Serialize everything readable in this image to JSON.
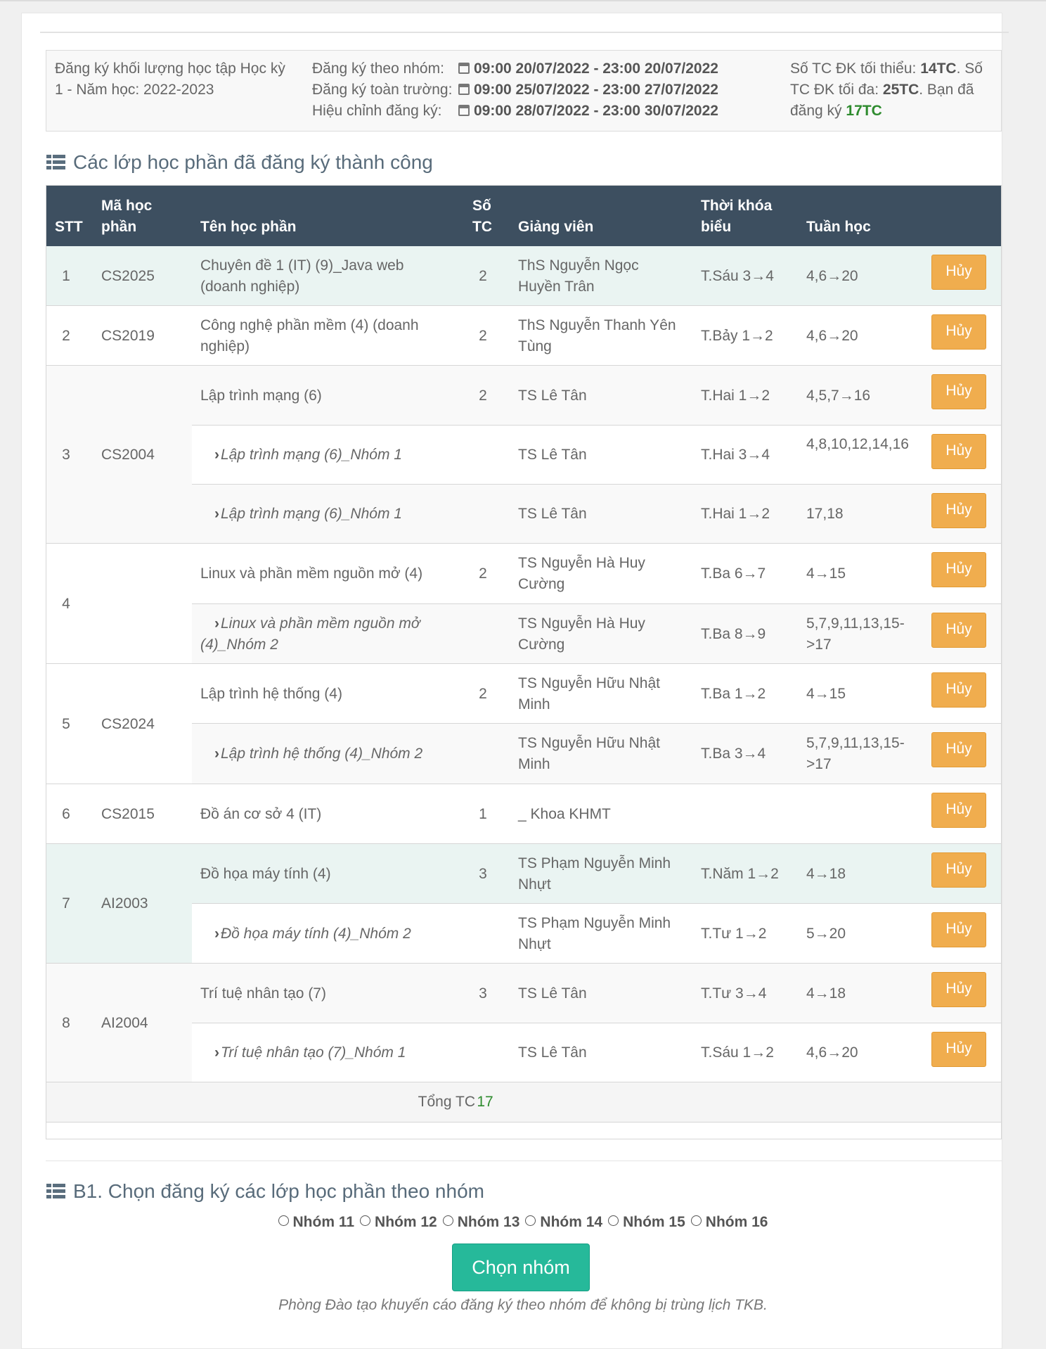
{
  "info": {
    "semester": "Đăng ký khối lượng học tập Học kỳ 1 - Năm học: 2022-2023",
    "periods": [
      {
        "label": "Đăng ký theo nhóm:",
        "value": "09:00 20/07/2022 - 23:00 20/07/2022"
      },
      {
        "label": "Đăng ký toàn trường:",
        "value": "09:00 25/07/2022 - 23:00 27/07/2022"
      },
      {
        "label": "Hiệu chỉnh đăng ký:",
        "value": "09:00 28/07/2022 - 23:00 30/07/2022"
      }
    ],
    "min_label": "Số TC ĐK tối thiểu:",
    "min_value": "14TC",
    "max_label": "Số TC ĐK tối đa:",
    "max_value": "25TC",
    "registered_label": "Bạn đã đăng ký",
    "registered_value": "17TC"
  },
  "section1_title": "Các lớp học phần đã đăng ký thành công",
  "table": {
    "headers": {
      "stt": "STT",
      "code": "Mã học phần",
      "name": "Tên học phần",
      "credits": "Số TC",
      "lecturer": "Giảng viên",
      "schedule": "Thời khóa biểu",
      "weeks": "Tuần học"
    },
    "cancel_label": "Hủy",
    "rows": [
      {
        "stt": "1",
        "code": "CS2025",
        "name": "Chuyên đề 1 (IT) (9)_Java web (doanh nghiệp)",
        "credits": "2",
        "lecturer": "ThS Nguyễn Ngọc Huyền Trân",
        "schedule": "T.Sáu 3→4",
        "weeks": "4,6→20"
      },
      {
        "stt": "2",
        "code": "CS2019",
        "name": "Công nghệ phần mềm (4) (doanh nghiệp)",
        "credits": "2",
        "lecturer": "ThS Nguyễn Thanh Yên Tùng",
        "schedule": "T.Bảy 1→2",
        "weeks": "4,6→20"
      },
      {
        "stt": "3",
        "code": "CS2004",
        "name": "Lập trình mạng (6)",
        "credits": "2",
        "lecturer": "TS Lê Tân",
        "schedule": "T.Hai 1→2",
        "weeks": "4,5,7→16"
      },
      {
        "name": "Lập trình mạng (6)_Nhóm 1",
        "lecturer": "TS Lê Tân",
        "schedule": "T.Hai 3→4",
        "weeks": "4,8,10,12,14,16"
      },
      {
        "name": "Lập trình mạng (6)_Nhóm 1",
        "lecturer": "TS Lê Tân",
        "schedule": "T.Hai 1→2",
        "weeks": "17,18"
      },
      {
        "stt": "4",
        "code": "",
        "name": "Linux và phần mềm nguồn mở (4)",
        "credits": "2",
        "lecturer": "TS Nguyễn Hà Huy Cường",
        "schedule": "T.Ba 6→7",
        "weeks": "4→15"
      },
      {
        "name": "Linux và phần mềm nguồn mở (4)_Nhóm 2",
        "lecturer": "TS Nguyễn Hà Huy Cường",
        "schedule": "T.Ba 8→9",
        "weeks": "5,7,9,11,13,15->17"
      },
      {
        "stt": "5",
        "code": "CS2024",
        "name": "Lập trình hệ thống (4)",
        "credits": "2",
        "lecturer": "TS Nguyễn Hữu Nhật Minh",
        "schedule": "T.Ba 1→2",
        "weeks": "4→15"
      },
      {
        "name": "Lập trình hệ thống (4)_Nhóm 2",
        "lecturer": "TS Nguyễn Hữu Nhật Minh",
        "schedule": "T.Ba 3→4",
        "weeks": "5,7,9,11,13,15->17"
      },
      {
        "stt": "6",
        "code": "CS2015",
        "name": "Đồ án cơ sở 4 (IT)",
        "credits": "1",
        "lecturer": "_ Khoa KHMT",
        "schedule": "",
        "weeks": ""
      },
      {
        "stt": "7",
        "code": "AI2003",
        "name": "Đồ họa máy tính (4)",
        "credits": "3",
        "lecturer": "TS Phạm Nguyễn Minh Nhựt",
        "schedule": "T.Năm 1→2",
        "weeks": "4→18"
      },
      {
        "name": "Đồ họa máy tính (4)_Nhóm 2",
        "lecturer": "TS Phạm Nguyễn Minh Nhựt",
        "schedule": "T.Tư 1→2",
        "weeks": "5→20"
      },
      {
        "stt": "8",
        "code": "AI2004",
        "name": "Trí tuệ nhân tạo (7)",
        "credits": "3",
        "lecturer": "TS Lê Tân",
        "schedule": "T.Tư 3→4",
        "weeks": "4→18"
      },
      {
        "name": "Trí tuệ nhân tạo (7)_Nhóm 1",
        "lecturer": "TS Lê Tân",
        "schedule": "T.Sáu 1→2",
        "weeks": "4,6→20"
      }
    ],
    "total_label": "Tổng TC",
    "total_value": "17"
  },
  "section2_title": "B1. Chọn đăng ký các lớp học phần theo nhóm",
  "groups": [
    "Nhóm 11",
    "Nhóm 12",
    "Nhóm 13",
    "Nhóm 14",
    "Nhóm 15",
    "Nhóm 16"
  ],
  "choose_button": "Chọn nhóm",
  "note": "Phòng Đào tạo khuyến cáo đăng ký theo nhóm để không bị trùng lịch TKB.",
  "colors": {
    "header_bg": "#3d4f60",
    "cancel_button": "#f0ad4e",
    "choose_button": "#26b99a",
    "highlight_row": "#eaf4f2",
    "stripe_row": "#f9f9f9",
    "accent_green": "#2e8b2e"
  }
}
